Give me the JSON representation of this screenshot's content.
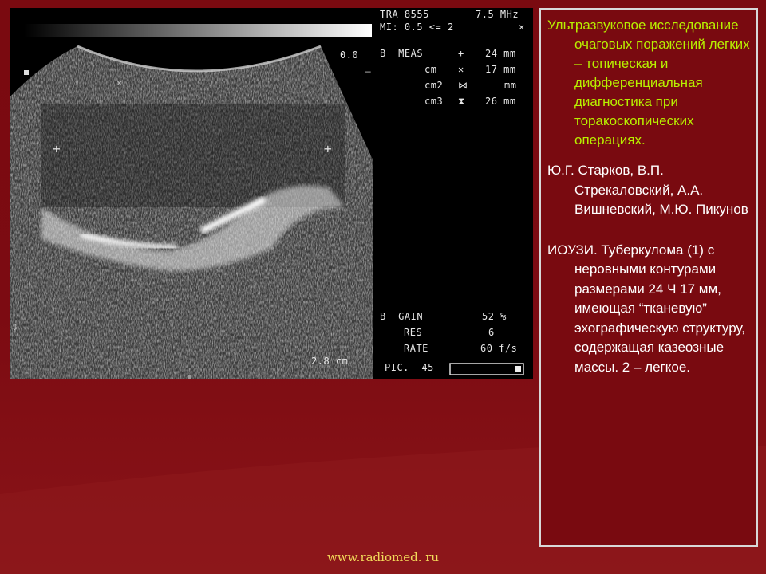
{
  "scan": {
    "header_left": "TRA 8555",
    "header_freq": "7.5 MHz",
    "mi": "MI: 0.5 <= 2",
    "mi_icon": "x-mark",
    "depth_zero": "0.0",
    "meas_label": "B  MEAS",
    "meas_icon": "plus-cross",
    "meas_value": "24 mm",
    "cm_rows": [
      {
        "label": "cm",
        "icon": "x-mark",
        "value": "17 mm"
      },
      {
        "label": "cm2",
        "icon": "hourglass-x",
        "value": "mm"
      },
      {
        "label": "cm3",
        "icon": "hourglass",
        "value": "26 mm"
      }
    ],
    "gain_label": "B  GAIN",
    "gain_value": "52 %",
    "res_label": "RES",
    "res_value": "6",
    "rate_label": "RATE",
    "rate_value": "60 f/s",
    "pic_label": "PIC.  45",
    "depth_scale": "2.8 cm"
  },
  "panel": {
    "title": "Ультразвуковое исследование очаговых поражений легких – топическая и дифференциальная диагностика при торакоскопических операциях.",
    "authors": "Ю.Г. Старков, В.П. Стрекаловский, А.А. Вишневский, М.Ю. Пикунов",
    "description": "ИОУЗИ. Туберкулома (1) с неровными контурами размерами 24 Ч 17 мм, имеющая “тканевую” эхографическую структуру, содержащая казеозные массы. 2 – легкое."
  },
  "footer": {
    "site": "www.radiomed. ru"
  },
  "colors": {
    "background": "#7a0a10",
    "title": "#b8f000",
    "footer": "#f2d95a"
  }
}
